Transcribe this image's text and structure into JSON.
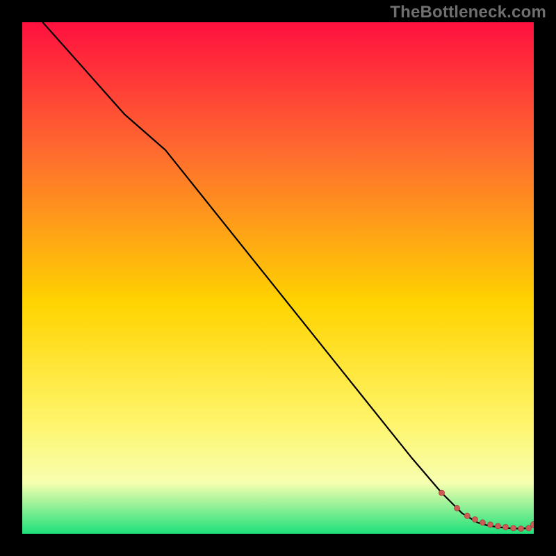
{
  "watermark": "TheBottleneck.com",
  "colors": {
    "bg_black": "#000000",
    "grad_top": "#ff103f",
    "grad_mid_upper": "#ff6a2f",
    "grad_mid": "#ffd400",
    "grad_mid_lower": "#fff56a",
    "grad_pale": "#f7ffb0",
    "grad_green": "#1ee07a",
    "curve": "#000000",
    "marker_fill": "#ce5b55",
    "marker_stroke": "#a7403b"
  },
  "chart_data": {
    "type": "line",
    "title": "",
    "xlabel": "",
    "ylabel": "",
    "xlim": [
      0,
      100
    ],
    "ylim": [
      0,
      100
    ],
    "series": [
      {
        "name": "curve",
        "x": [
          4,
          12,
          20,
          28,
          40,
          52,
          64,
          76,
          82,
          86,
          89,
          91,
          93,
          95,
          97,
          99,
          100
        ],
        "y": [
          100,
          91,
          82,
          75,
          60,
          45,
          30,
          15,
          8,
          4,
          2.2,
          1.6,
          1.3,
          1.1,
          1.0,
          1.1,
          1.8
        ]
      }
    ],
    "markers": {
      "name": "highlight-points",
      "x": [
        82,
        85,
        87,
        88.5,
        90,
        91.5,
        93,
        94.5,
        96,
        97.5,
        99,
        100
      ],
      "y": [
        8,
        5,
        3.5,
        2.8,
        2.2,
        1.8,
        1.5,
        1.3,
        1.1,
        1.0,
        1.1,
        1.8
      ]
    }
  }
}
